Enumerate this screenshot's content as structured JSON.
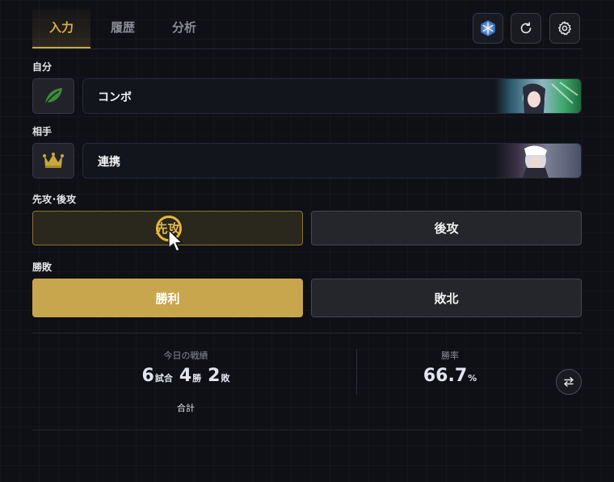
{
  "tabs": [
    {
      "label": "入力",
      "active": true
    },
    {
      "label": "履歴",
      "active": false
    },
    {
      "label": "分析",
      "active": false
    }
  ],
  "toolbar": {
    "icons": [
      "snowflake-app-icon",
      "refresh-icon",
      "gear-icon"
    ]
  },
  "self": {
    "label": "自分",
    "deck_icon": "leaf-icon",
    "deck_name": "コンボ"
  },
  "opponent": {
    "label": "相手",
    "deck_icon": "crown-icon",
    "deck_name": "連携"
  },
  "turn_order": {
    "label": "先攻･後攻",
    "options": [
      {
        "label": "先攻",
        "selected": true
      },
      {
        "label": "後攻",
        "selected": false
      }
    ]
  },
  "result": {
    "label": "勝敗",
    "options": [
      {
        "label": "勝利",
        "selected": true
      },
      {
        "label": "敗北",
        "selected": false
      }
    ]
  },
  "stats": {
    "today_caption": "今日の戦績",
    "games": "6",
    "games_unit": "試合",
    "wins": "4",
    "wins_unit": "勝",
    "losses": "2",
    "losses_unit": "敗",
    "total_label": "合計",
    "rate_caption": "勝率",
    "rate_value": "66.7",
    "rate_unit": "%"
  },
  "colors": {
    "accent": "#c8a64d",
    "background": "#0f1015"
  }
}
